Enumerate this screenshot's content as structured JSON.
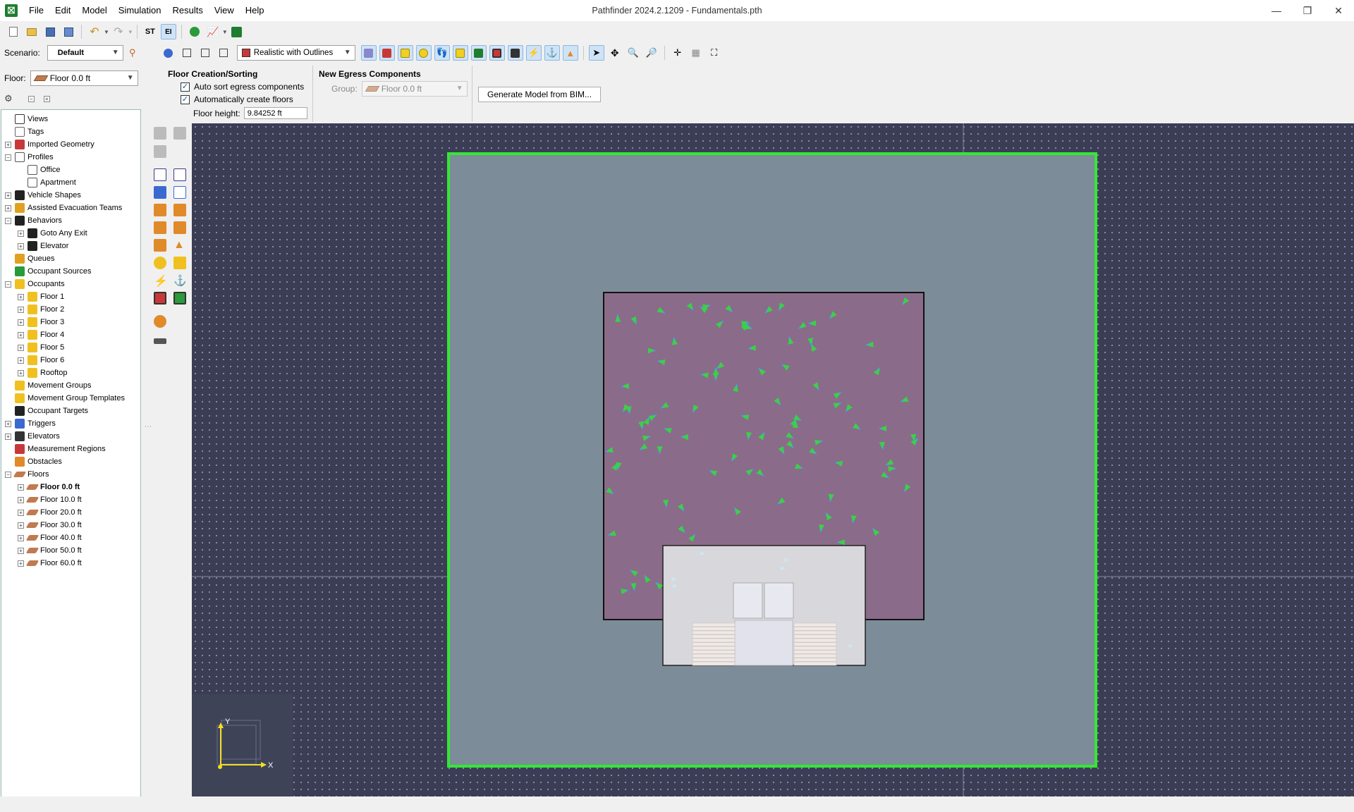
{
  "window": {
    "title": "Pathfinder 2024.2.1209 - Fundamentals.pth",
    "app_icon": "pathfinder-logo-icon"
  },
  "menu": [
    "File",
    "Edit",
    "Model",
    "Simulation",
    "Results",
    "View",
    "Help"
  ],
  "toolbar": {
    "st_label": "ST",
    "ei_label": "EI",
    "scenario_label": "Scenario:",
    "scenario_value": "Default",
    "view_mode": "Realistic with Outlines"
  },
  "floor_selector": {
    "label": "Floor:",
    "value": "Floor 0.0 ft"
  },
  "properties": {
    "floor_creation": {
      "title": "Floor Creation/Sorting",
      "auto_sort": "Auto sort egress components",
      "auto_create": "Automatically create floors",
      "height_label": "Floor height:",
      "height_value": "9.84252 ft"
    },
    "new_egress": {
      "title": "New Egress Components",
      "group_label": "Group:",
      "group_value": "Floor 0.0 ft"
    },
    "generate_button": "Generate Model from BIM..."
  },
  "tree": {
    "items": [
      {
        "label": "Views",
        "indent": 0,
        "expander": "",
        "icon": "views-icon",
        "color": "#333333"
      },
      {
        "label": "Tags",
        "indent": 0,
        "expander": "",
        "icon": "tag-icon",
        "color": "#666666"
      },
      {
        "label": "Imported Geometry",
        "indent": 0,
        "expander": "+",
        "icon": "geometry-icon",
        "color": "#c83838"
      },
      {
        "label": "Profiles",
        "indent": 0,
        "expander": "-",
        "icon": "profile-icon",
        "color": "#555555"
      },
      {
        "label": "Office",
        "indent": 1,
        "expander": "",
        "icon": "profile-icon",
        "color": "#555555"
      },
      {
        "label": "Apartment",
        "indent": 1,
        "expander": "",
        "icon": "profile-icon",
        "color": "#555555"
      },
      {
        "label": "Vehicle Shapes",
        "indent": 0,
        "expander": "+",
        "icon": "wheelchair-icon",
        "color": "#222222"
      },
      {
        "label": "Assisted Evacuation Teams",
        "indent": 0,
        "expander": "+",
        "icon": "team-icon",
        "color": "#e0a020"
      },
      {
        "label": "Behaviors",
        "indent": 0,
        "expander": "-",
        "icon": "footsteps-icon",
        "color": "#222222"
      },
      {
        "label": "Goto Any Exit",
        "indent": 1,
        "expander": "+",
        "icon": "footsteps-icon",
        "color": "#222222"
      },
      {
        "label": "Elevator",
        "indent": 1,
        "expander": "+",
        "icon": "footsteps-icon",
        "color": "#222222"
      },
      {
        "label": "Queues",
        "indent": 0,
        "expander": "",
        "icon": "queue-icon",
        "color": "#e0a020"
      },
      {
        "label": "Occupant Sources",
        "indent": 0,
        "expander": "",
        "icon": "source-icon",
        "color": "#2a9a3a"
      },
      {
        "label": "Occupants",
        "indent": 0,
        "expander": "-",
        "icon": "occupant-icon",
        "color": "#f0c020"
      },
      {
        "label": "Floor 1",
        "indent": 1,
        "expander": "+",
        "icon": "occupant-icon",
        "color": "#f0c020"
      },
      {
        "label": "Floor 2",
        "indent": 1,
        "expander": "+",
        "icon": "occupant-icon",
        "color": "#f0c020"
      },
      {
        "label": "Floor 3",
        "indent": 1,
        "expander": "+",
        "icon": "occupant-icon",
        "color": "#f0c020"
      },
      {
        "label": "Floor 4",
        "indent": 1,
        "expander": "+",
        "icon": "occupant-icon",
        "color": "#f0c020"
      },
      {
        "label": "Floor 5",
        "indent": 1,
        "expander": "+",
        "icon": "occupant-icon",
        "color": "#f0c020"
      },
      {
        "label": "Floor 6",
        "indent": 1,
        "expander": "+",
        "icon": "occupant-icon",
        "color": "#f0c020"
      },
      {
        "label": "Rooftop",
        "indent": 1,
        "expander": "+",
        "icon": "occupant-icon",
        "color": "#f0c020"
      },
      {
        "label": "Movement Groups",
        "indent": 0,
        "expander": "",
        "icon": "group-icon",
        "color": "#f0c020"
      },
      {
        "label": "Movement Group Templates",
        "indent": 0,
        "expander": "",
        "icon": "group-icon",
        "color": "#f0c020"
      },
      {
        "label": "Occupant Targets",
        "indent": 0,
        "expander": "",
        "icon": "target-icon",
        "color": "#222222"
      },
      {
        "label": "Triggers",
        "indent": 0,
        "expander": "+",
        "icon": "trigger-icon",
        "color": "#3a6ad0"
      },
      {
        "label": "Elevators",
        "indent": 0,
        "expander": "+",
        "icon": "elevator-icon",
        "color": "#333333"
      },
      {
        "label": "Measurement Regions",
        "indent": 0,
        "expander": "",
        "icon": "measure-icon",
        "color": "#c83838"
      },
      {
        "label": "Obstacles",
        "indent": 0,
        "expander": "",
        "icon": "obstacle-icon",
        "color": "#e08a2a"
      },
      {
        "label": "Floors",
        "indent": 0,
        "expander": "-",
        "icon": "floor-icon",
        "color": "#c07a50"
      },
      {
        "label": "Floor 0.0 ft",
        "indent": 1,
        "expander": "+",
        "icon": "floor-icon",
        "color": "#c07a50",
        "bold": true
      },
      {
        "label": "Floor 10.0 ft",
        "indent": 1,
        "expander": "+",
        "icon": "floor-icon",
        "color": "#c07a50"
      },
      {
        "label": "Floor 20.0 ft",
        "indent": 1,
        "expander": "+",
        "icon": "floor-icon",
        "color": "#c07a50"
      },
      {
        "label": "Floor 30.0 ft",
        "indent": 1,
        "expander": "+",
        "icon": "floor-icon",
        "color": "#c07a50"
      },
      {
        "label": "Floor 40.0 ft",
        "indent": 1,
        "expander": "+",
        "icon": "floor-icon",
        "color": "#c07a50"
      },
      {
        "label": "Floor 50.0 ft",
        "indent": 1,
        "expander": "+",
        "icon": "floor-icon",
        "color": "#c07a50"
      },
      {
        "label": "Floor 60.0 ft",
        "indent": 1,
        "expander": "+",
        "icon": "floor-icon",
        "color": "#c07a50"
      }
    ]
  },
  "viewport": {
    "axis_x": "X",
    "axis_y": "Y",
    "colors": {
      "background": "#3b3d55",
      "ground": "#7c8c99",
      "boundary": "#33e833",
      "room": "#8b6b8a",
      "stair_area": "#d8d8dc",
      "occupant_arrow": "#3ad04a",
      "occupant_tip": "#3aa8f0"
    }
  }
}
